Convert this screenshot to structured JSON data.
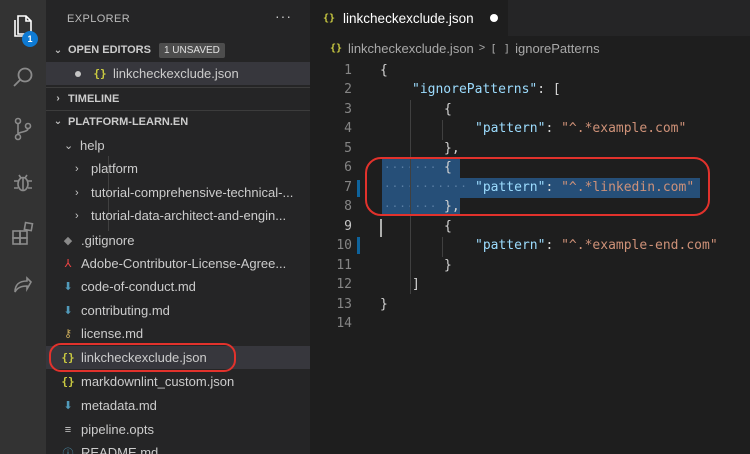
{
  "activity_bar": {
    "items": [
      "files-icon",
      "search-icon",
      "source-control-icon",
      "debug-icon",
      "extensions-icon",
      "live-share-icon"
    ],
    "explorer_badge": "1",
    "badge_color": "#0e7ad3"
  },
  "sidebar": {
    "title": "EXPLORER",
    "more": "···",
    "open_editors": {
      "label": "OPEN EDITORS",
      "badge": "1 UNSAVED",
      "files": [
        {
          "name": "linkcheckexclude.json",
          "icon": "{}"
        }
      ]
    },
    "timeline": {
      "label": "TIMELINE"
    },
    "project": {
      "label": "PLATFORM-LEARN.EN",
      "items": [
        {
          "name": "help",
          "kind": "folder-open"
        },
        {
          "name": "platform",
          "kind": "folder-closed"
        },
        {
          "name": "tutorial-comprehensive-technical-...",
          "kind": "folder-closed"
        },
        {
          "name": "tutorial-data-architect-and-engin...",
          "kind": "folder-closed"
        },
        {
          "name": ".gitignore",
          "icon": "◆"
        },
        {
          "name": "Adobe-Contributor-License-Agree...",
          "icon": "⅄"
        },
        {
          "name": "code-of-conduct.md",
          "icon": "⬇"
        },
        {
          "name": "contributing.md",
          "icon": "⬇"
        },
        {
          "name": "license.md",
          "icon": "⚷"
        },
        {
          "name": "linkcheckexclude.json",
          "icon": "{}"
        },
        {
          "name": "markdownlint_custom.json",
          "icon": "{}"
        },
        {
          "name": "metadata.md",
          "icon": "⬇"
        },
        {
          "name": "pipeline.opts",
          "icon": "≡"
        },
        {
          "name": "README.md",
          "icon": "ⓘ"
        }
      ]
    }
  },
  "tab": {
    "icon": "{}",
    "title": "linkcheckexclude.json"
  },
  "breadcrumb": {
    "file": "linkcheckexclude.json",
    "separator": ">",
    "symbol_icon": "[ ]",
    "symbol": "ignorePatterns"
  },
  "editor": {
    "lines": [
      {
        "n": "1",
        "text": "{"
      },
      {
        "n": "2",
        "key": "\"ignorePatterns\"",
        "rest": ": ["
      },
      {
        "n": "3",
        "text": "{"
      },
      {
        "n": "4",
        "key": "\"pattern\"",
        "colon": ": ",
        "val": "\"^.*example.com\""
      },
      {
        "n": "5",
        "text": "},"
      },
      {
        "n": "6",
        "text": "{"
      },
      {
        "n": "7",
        "key": "\"pattern\"",
        "colon": ": ",
        "val": "\"^.*linkedin.com\""
      },
      {
        "n": "8",
        "text": "},"
      },
      {
        "n": "9",
        "text": "{"
      },
      {
        "n": "10",
        "key": "\"pattern\"",
        "colon": ": ",
        "val": "\"^.*example-end.com\""
      },
      {
        "n": "11",
        "text": "}"
      },
      {
        "n": "12",
        "text": "]"
      },
      {
        "n": "13",
        "text": "}"
      },
      {
        "n": "14",
        "text": ""
      }
    ],
    "active_line": "9"
  },
  "colors": {
    "selection": "#264f78",
    "annotation_oval": "#e2322c",
    "json_key": "#9cdcfe",
    "json_string": "#ce9178"
  }
}
